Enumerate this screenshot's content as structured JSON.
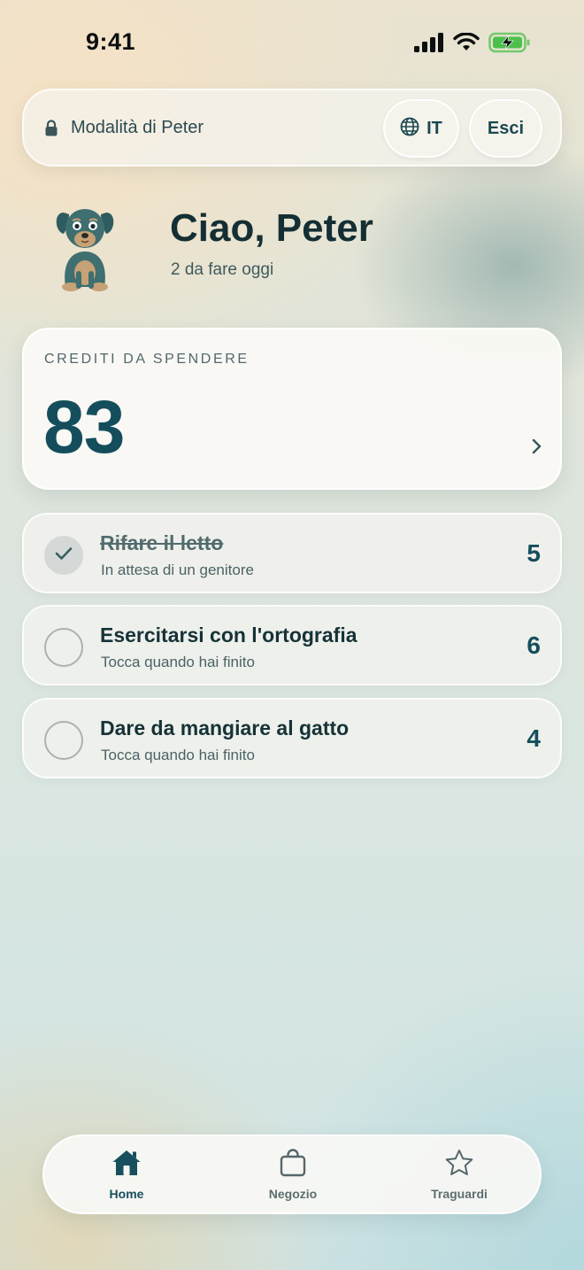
{
  "status_bar": {
    "time": "9:41",
    "icons": [
      "cellular-signal-icon",
      "wifi-icon",
      "battery-charging-icon"
    ]
  },
  "header": {
    "mode_icon": "lock-icon",
    "mode_label": "Modalità di Peter",
    "language_icon": "globe-icon",
    "language_label": "IT",
    "exit_label": "Esci"
  },
  "greeting": {
    "avatar_icon": "dog-avatar",
    "title": "Ciao, Peter",
    "subtitle": "2 da fare oggi"
  },
  "credits": {
    "label": "CREDITI DA SPENDERE",
    "value": "83",
    "chevron_icon": "chevron-right-icon"
  },
  "tasks": [
    {
      "title": "Rifare il letto",
      "subtitle": "In attesa di un genitore",
      "points": "5",
      "completed": true
    },
    {
      "title": "Esercitarsi con l'ortografia",
      "subtitle": "Tocca quando hai finito",
      "points": "6",
      "completed": false
    },
    {
      "title": "Dare da mangiare al gatto",
      "subtitle": "Tocca quando hai finito",
      "points": "4",
      "completed": false
    }
  ],
  "tab_bar": {
    "items": [
      {
        "label": "Home",
        "icon": "home-icon",
        "active": true
      },
      {
        "label": "Negozio",
        "icon": "shopping-bag-icon",
        "active": false
      },
      {
        "label": "Traguardi",
        "icon": "star-icon",
        "active": false
      }
    ]
  },
  "colors": {
    "accent": "#144e5c",
    "text_primary": "#142f34",
    "battery_green": "#4cc04a"
  }
}
